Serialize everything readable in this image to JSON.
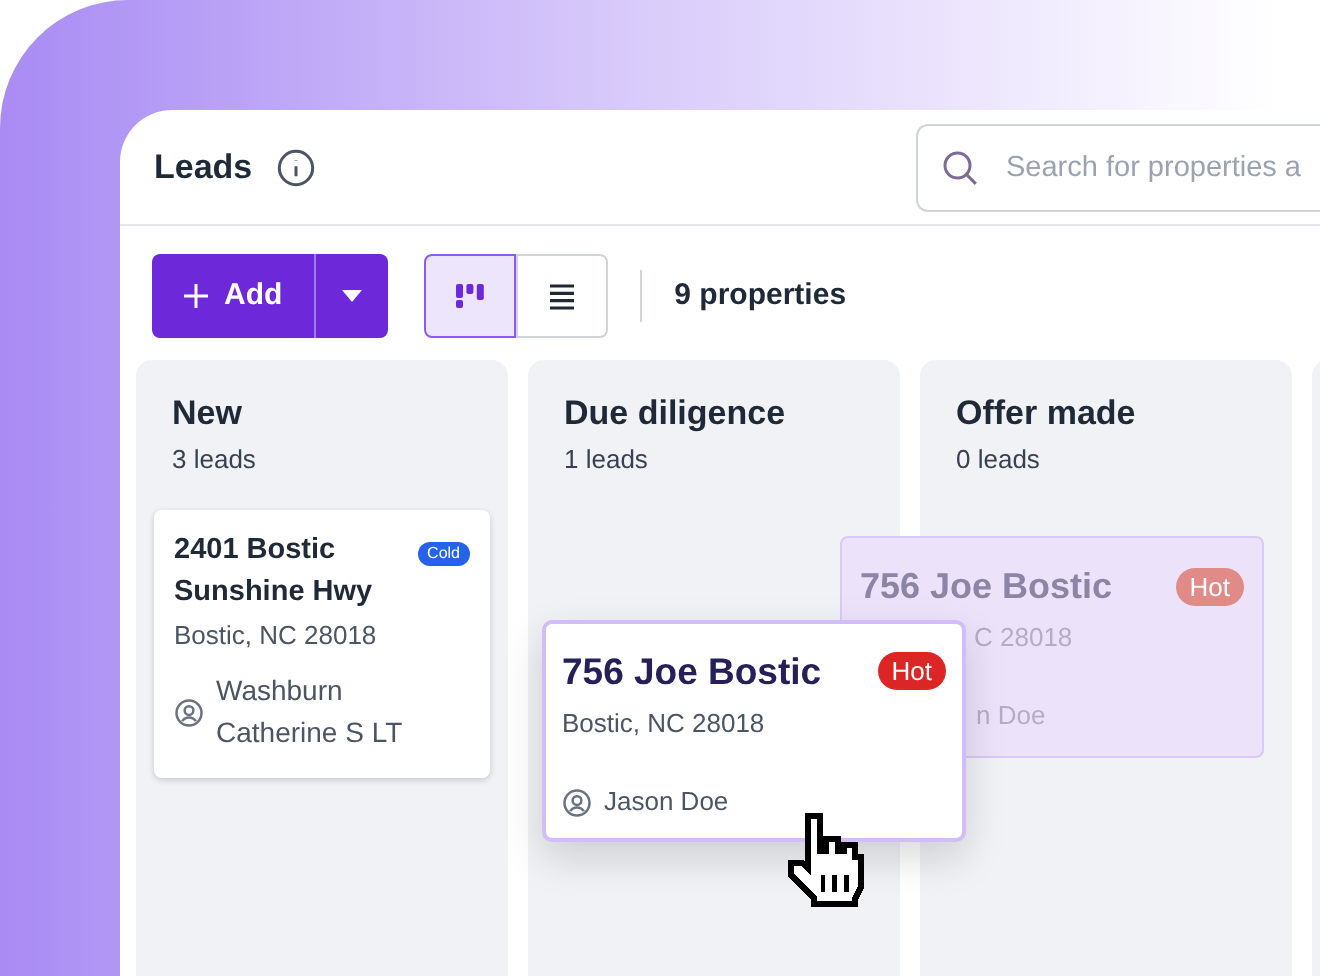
{
  "header": {
    "title": "Leads",
    "search": {
      "placeholder": "Search for properties a"
    }
  },
  "toolbar": {
    "add_label": "Add",
    "views": [
      {
        "kind": "board",
        "selected": true
      },
      {
        "kind": "list",
        "selected": false
      }
    ],
    "count": "9 properties"
  },
  "columns": [
    {
      "title": "New",
      "count": "3 leads",
      "cards": [
        {
          "title": "2401 Bostic Sunshine Hwy",
          "address": "Bostic, NC 28018",
          "owner": "Washburn Catherine S LT",
          "tag": {
            "label": "Cold",
            "color": "#2563eb"
          }
        }
      ]
    },
    {
      "title": "Due diligence",
      "count": "1 leads"
    },
    {
      "title": "Offer made",
      "count": "0 leads"
    }
  ],
  "drag": {
    "card": {
      "title": "756 Joe Bostic",
      "address": "Bostic, NC 28018",
      "owner": "Jason Doe",
      "tag": {
        "label": "Hot",
        "color": "#dc2626"
      }
    },
    "ghost": {
      "title": "756 Joe Bostic",
      "address": "C 28018",
      "owner": "n Doe",
      "tag": {
        "label": "Hot",
        "color": "#e08b87"
      }
    }
  }
}
